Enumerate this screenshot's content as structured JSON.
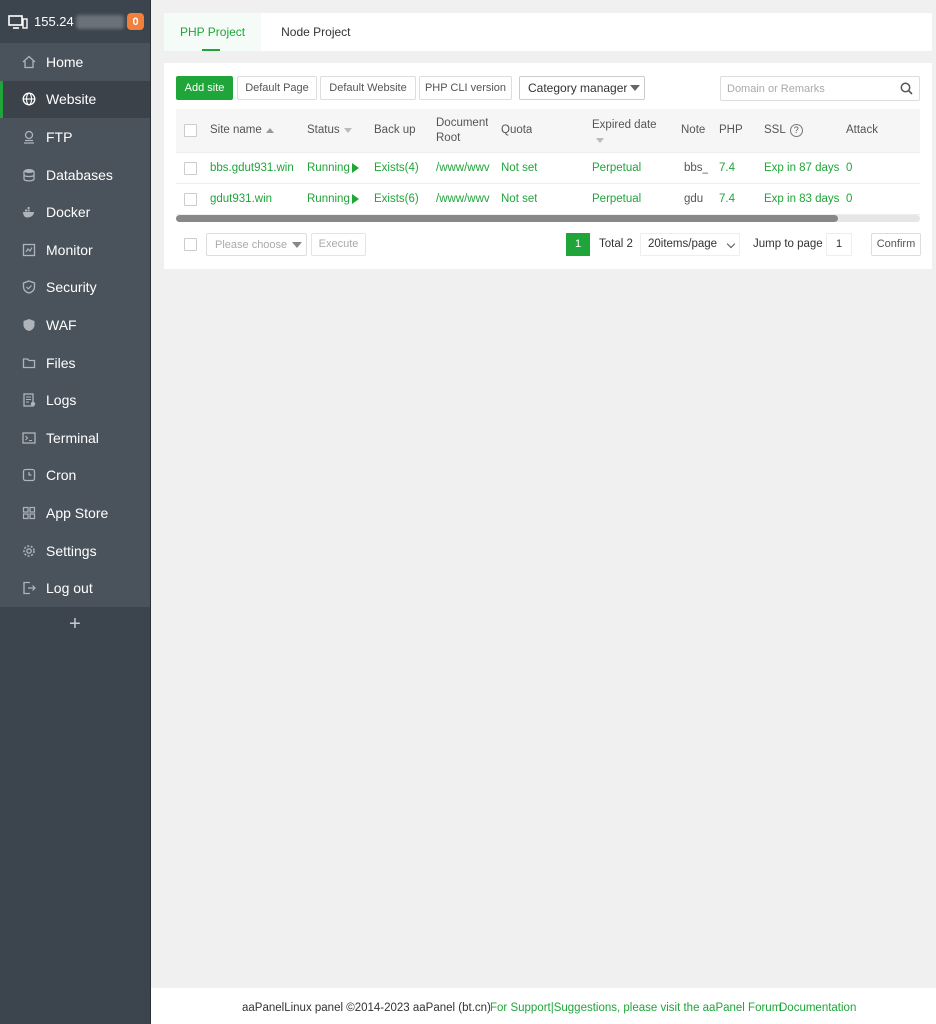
{
  "server": {
    "ip_prefix": "155.24",
    "notification_count": "0"
  },
  "sidebar": {
    "items": [
      {
        "label": "Home",
        "icon": "home-icon"
      },
      {
        "label": "Website",
        "icon": "globe-icon"
      },
      {
        "label": "FTP",
        "icon": "ftp-icon"
      },
      {
        "label": "Databases",
        "icon": "database-icon"
      },
      {
        "label": "Docker",
        "icon": "docker-icon"
      },
      {
        "label": "Monitor",
        "icon": "monitor-icon"
      },
      {
        "label": "Security",
        "icon": "shield-icon"
      },
      {
        "label": "WAF",
        "icon": "waf-shield-icon"
      },
      {
        "label": "Files",
        "icon": "folder-icon"
      },
      {
        "label": "Logs",
        "icon": "logs-icon"
      },
      {
        "label": "Terminal",
        "icon": "terminal-icon"
      },
      {
        "label": "Cron",
        "icon": "clock-icon"
      },
      {
        "label": "App Store",
        "icon": "grid-icon"
      },
      {
        "label": "Settings",
        "icon": "gear-icon"
      },
      {
        "label": "Log out",
        "icon": "logout-icon"
      }
    ],
    "active": "Website",
    "add_label": "+"
  },
  "tabs": [
    "PHP Project",
    "Node Project"
  ],
  "toolbar": {
    "add_site": "Add site",
    "default_page": "Default Page",
    "default_website": "Default Website",
    "php_cli": "PHP CLI version",
    "category_manager": "Category manager",
    "search_placeholder": "Domain or Remarks"
  },
  "table": {
    "headers": {
      "site_name": "Site name",
      "status": "Status",
      "backup": "Back up",
      "doc_root_1": "Document",
      "doc_root_2": "Root",
      "quota": "Quota",
      "expired": "Expired date",
      "note": "Note",
      "php": "PHP",
      "ssl": "SSL",
      "ssl_help": "?",
      "attack": "Attack"
    },
    "rows": [
      {
        "site": "bbs.gdut931.win",
        "status": "Running",
        "backup": "Exists(4)",
        "root": "/www/wwv",
        "quota": "Not set",
        "expired": "Perpetual",
        "note": "bbs_",
        "php": "7.4",
        "ssl": "Exp in 87 days",
        "attack": "0"
      },
      {
        "site": "gdut931.win",
        "status": "Running",
        "backup": "Exists(6)",
        "root": "/www/wwv",
        "quota": "Not set",
        "expired": "Perpetual",
        "note": "gdu",
        "php": "7.4",
        "ssl": "Exp in 83 days",
        "attack": "0"
      }
    ]
  },
  "batch": {
    "placeholder": "Please choose",
    "execute": "Execute"
  },
  "pagination": {
    "current": "1",
    "total": "Total 2",
    "per_page": "20items/page",
    "jump_label": "Jump to page",
    "jump_value": "1",
    "confirm": "Confirm"
  },
  "footer": {
    "copyright": "aaPanelLinux panel ©2014-2023 aaPanel (bt.cn)",
    "support": "For Support|Suggestions, please visit the aaPanel Forum",
    "docs": "Documentation"
  },
  "colors": {
    "accent": "#20a53a",
    "sidebar_bg": "#3c444d",
    "badge": "#f0803c"
  }
}
